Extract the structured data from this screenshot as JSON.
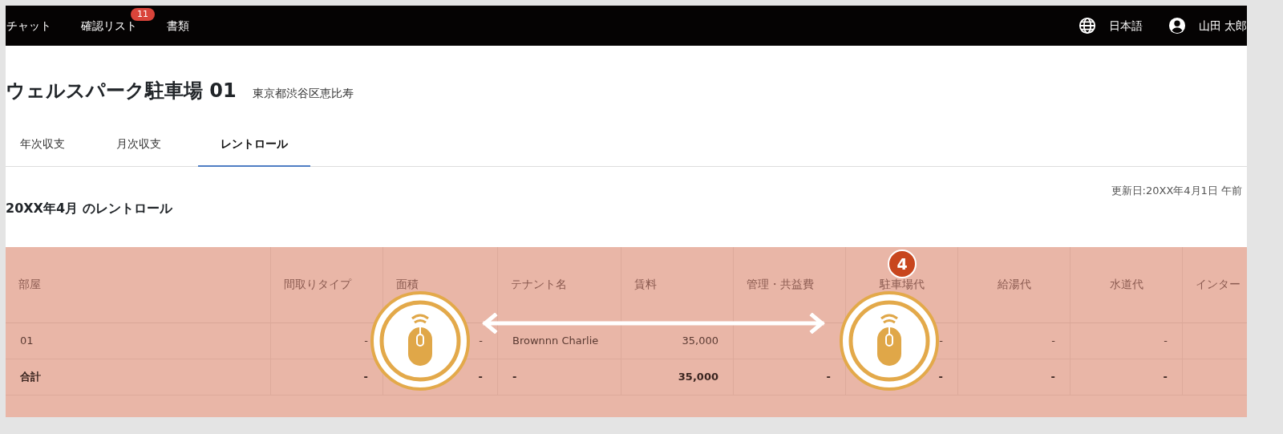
{
  "nav": {
    "items": [
      {
        "label": "チャット"
      },
      {
        "label": "確認リスト",
        "badge": "11"
      },
      {
        "label": "書類"
      }
    ],
    "language": "日本語",
    "user": "山田 太郎"
  },
  "property": {
    "title": "ウェルスパーク駐車場 01",
    "address": "東京都渋谷区恵比寿"
  },
  "tabs": [
    {
      "label": "年次収支",
      "selected": false
    },
    {
      "label": "月次収支",
      "selected": false
    },
    {
      "label": "レントロール",
      "selected": true
    }
  ],
  "section": {
    "heading": "20XX年4月 のレントロール",
    "updated": "更新日:20XX年4月1日 午前"
  },
  "table": {
    "columns": [
      "部屋",
      "間取りタイプ",
      "面積",
      "テナント名",
      "賃料",
      "管理・共益費",
      "駐車場代",
      "給湯代",
      "水道代",
      "インター"
    ],
    "rows": [
      {
        "kind": "data",
        "cells": [
          "01",
          "-",
          "-",
          "Brownnn Charlie",
          "35,000",
          "",
          "-",
          "-",
          "-",
          ""
        ]
      },
      {
        "kind": "total",
        "cells": [
          "合計",
          "-",
          "-",
          "-",
          "35,000",
          "-",
          "-",
          "-",
          "-",
          ""
        ]
      }
    ]
  },
  "step_badge": "4"
}
